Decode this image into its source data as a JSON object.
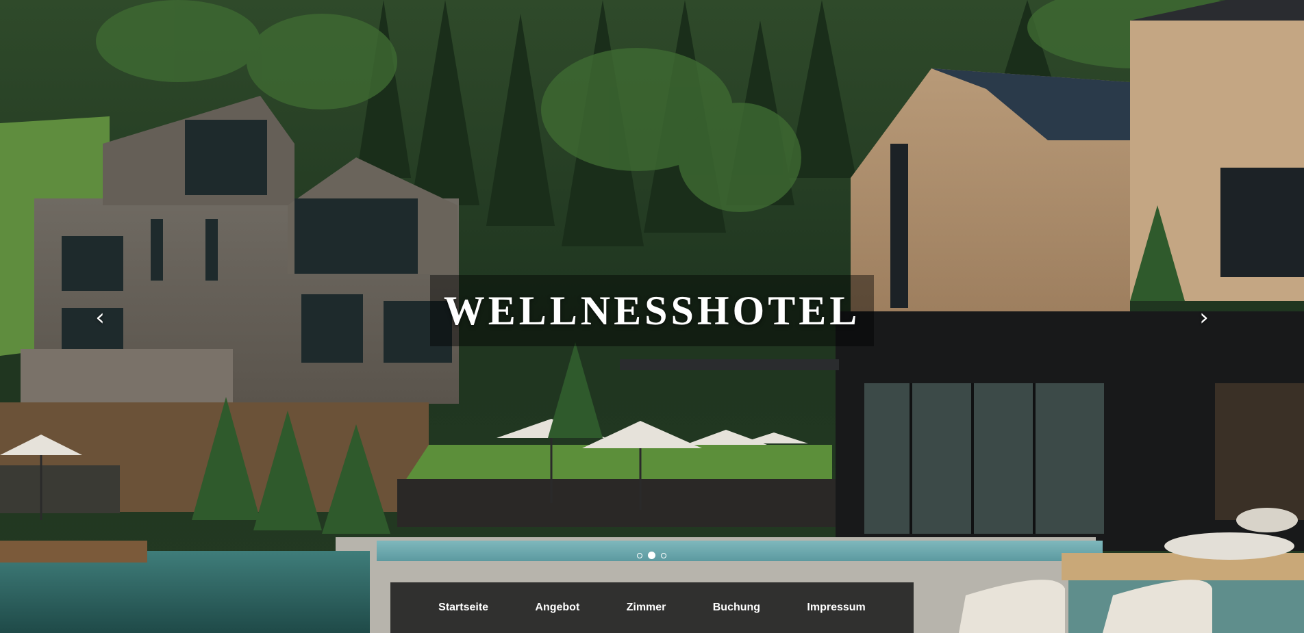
{
  "hero": {
    "title": "WELLNESSHOTEL"
  },
  "carousel": {
    "prev_icon": "chevron-left-icon",
    "next_icon": "chevron-right-icon",
    "prev_glyph": "‹",
    "next_glyph": "›",
    "slide_count": 3,
    "active_slide": 2
  },
  "nav": {
    "items": [
      {
        "label": "Startseite"
      },
      {
        "label": "Angebot"
      },
      {
        "label": "Zimmer"
      },
      {
        "label": "Buchung"
      },
      {
        "label": "Impressum"
      }
    ]
  },
  "colors": {
    "overlay": "#000000",
    "nav_bg": "#1e1e1e",
    "text": "#ffffff"
  }
}
